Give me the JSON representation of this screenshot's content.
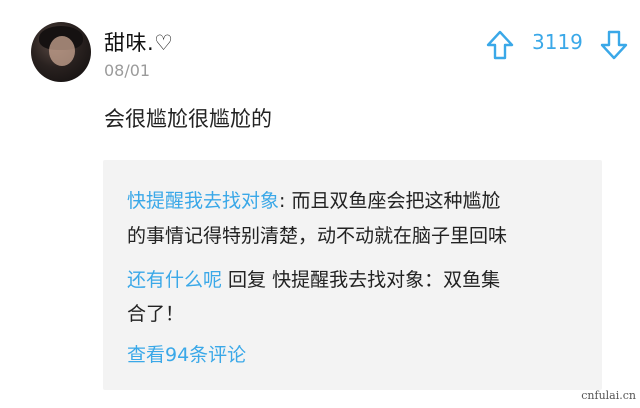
{
  "post": {
    "username": "甜味.♡",
    "date": "08/01",
    "vote_count": "3119",
    "content": "会很尴尬很尴尬的"
  },
  "quote": {
    "line1_author": "快提醒我去找对象",
    "line1_sep": ": ",
    "line1_text": "而且双鱼座会把这种尴尬",
    "line2_text": "的事情记得特别清楚，动不动就在脑子里回味",
    "reply_user": "还有什么呢",
    "reply_word": " 回复 ",
    "reply_target": "快提醒我去找对象",
    "reply_sep": "：",
    "reply_text1": "双鱼集",
    "reply_text2": "合了！",
    "view_more": "查看94条评论"
  },
  "icons": {
    "upvote": "arrow-up-outline-icon",
    "downvote": "arrow-down-outline-icon"
  },
  "colors": {
    "accent": "#3aa8e8",
    "box_bg": "#f3f3f3",
    "muted": "#9b9b9b"
  },
  "watermark": "cnfulai.cn"
}
